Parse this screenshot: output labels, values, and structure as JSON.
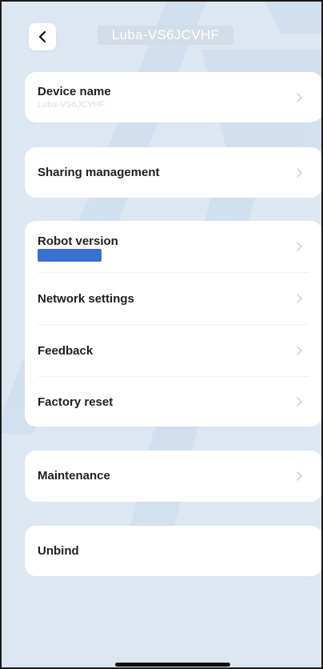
{
  "header": {
    "title": "Luba-VS6JCVHF"
  },
  "device_name": {
    "label": "Device name",
    "value": "Luba-VS6JCVHF"
  },
  "sharing": {
    "label": "Sharing management"
  },
  "group": {
    "robot_version": "Robot version",
    "network_settings": "Network settings",
    "feedback": "Feedback",
    "factory_reset": "Factory reset"
  },
  "maintenance": {
    "label": "Maintenance"
  },
  "unbind": {
    "label": "Unbind"
  },
  "colors": {
    "background": "#dde7f1",
    "card": "#ffffff",
    "redaction": "#3b6fd0"
  }
}
